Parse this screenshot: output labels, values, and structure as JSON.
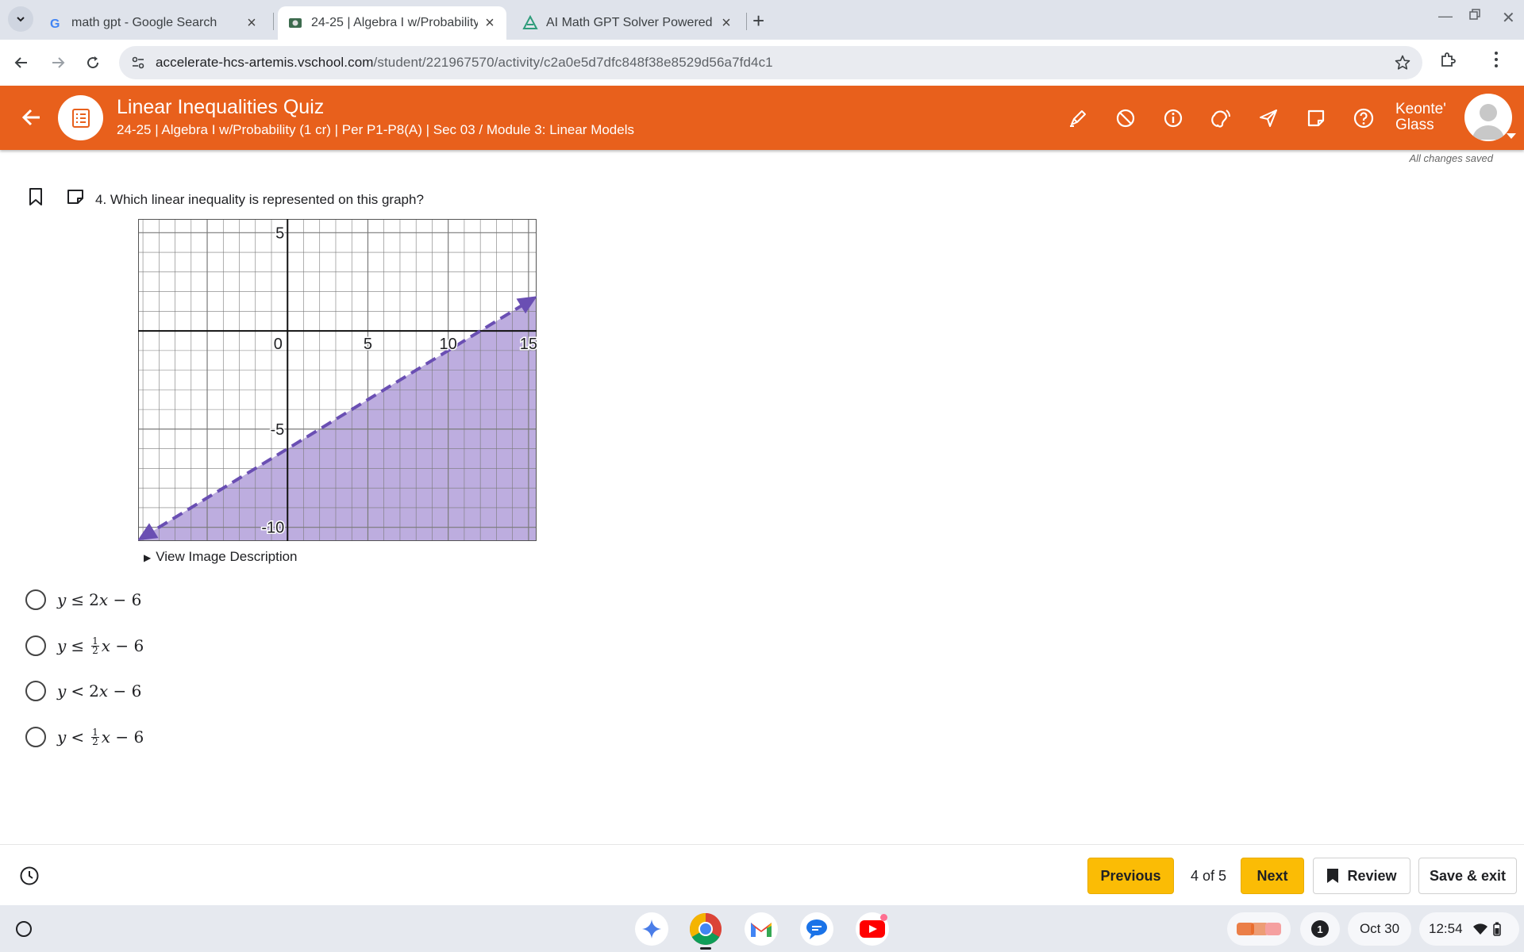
{
  "browser": {
    "tabs": [
      {
        "title": "math gpt - Google Search"
      },
      {
        "title": "24-25 | Algebra I w/Probability (",
        "active": true
      },
      {
        "title": "AI Math GPT Solver Powered by"
      }
    ],
    "new_tab": "+",
    "url_host": "accelerate-hcs-artemis.vschool.com",
    "url_path": "/student/221967570/activity/c2a0e5d7dfc848f38e8529d56a7fd4c1"
  },
  "header": {
    "title": "Linear Inequalities Quiz",
    "subtitle": "24-25 | Algebra I w/Probability (1 cr) | Per P1-P8(A) | Sec 03 / Module 3: Linear Models",
    "user_first": "Keonte'",
    "user_last": "Glass",
    "accent": "#e8601c"
  },
  "status": {
    "saved": "All changes saved"
  },
  "question": {
    "text": "4. Which linear inequality is represented on this graph?",
    "image_description_label": "View Image Description",
    "graph": {
      "x_range": [
        -9.3,
        15.5
      ],
      "y_range": [
        -10.7,
        5.7
      ],
      "x_ticks": [
        "0",
        "5",
        "10",
        "15"
      ],
      "y_ticks": [
        "5",
        "-5",
        "-10"
      ],
      "line_slope": 0.5,
      "line_intercept": -6,
      "line_style": "dashed",
      "shading": "below",
      "fill_color": "#b9a9dd",
      "line_color": "#6a4fb3"
    },
    "choices": [
      {
        "lhs": "y",
        "op": "≤",
        "coef": "2",
        "rest": "x − 6"
      },
      {
        "lhs": "y",
        "op": "≤",
        "frac_num": "1",
        "frac_den": "2",
        "rest": "x − 6"
      },
      {
        "lhs": "y",
        "op": "<",
        "coef": "2",
        "rest": "x − 6"
      },
      {
        "lhs": "y",
        "op": "<",
        "frac_num": "1",
        "frac_den": "2",
        "rest": "x − 6"
      }
    ]
  },
  "footer": {
    "previous": "Previous",
    "page": "4 of 5",
    "next": "Next",
    "review": "Review",
    "save_exit": "Save & exit"
  },
  "shelf": {
    "notification_count": "1",
    "date": "Oct 30",
    "time": "12:54"
  }
}
